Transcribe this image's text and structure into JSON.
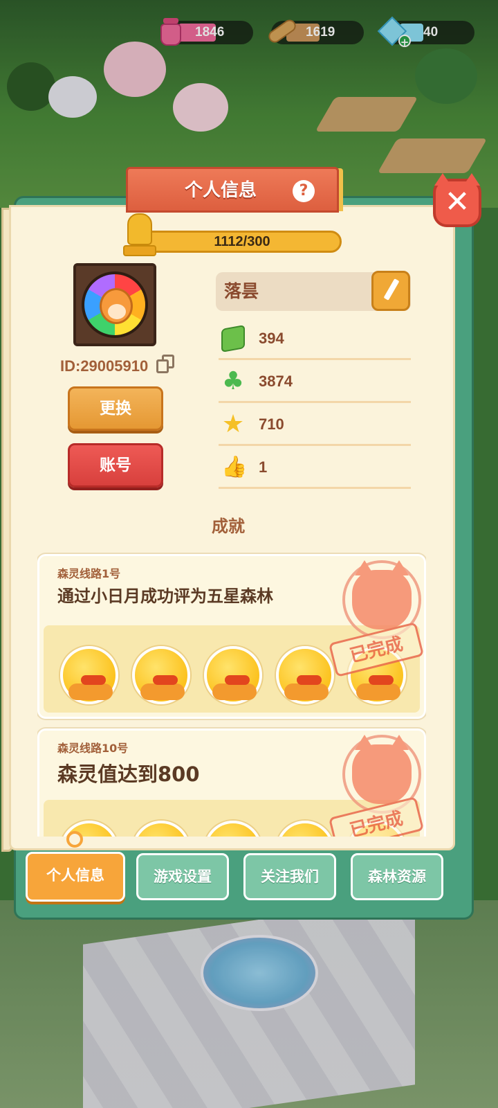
{
  "currencies": [
    {
      "icon": "ink-jar-icon",
      "value": "1846",
      "color": "#f06a9b"
    },
    {
      "icon": "wood-log-icon",
      "value": "1619",
      "color": "#d9a55a"
    },
    {
      "icon": "crystal-gem-icon",
      "value": "40",
      "color": "#8fe0f5"
    }
  ],
  "panel": {
    "title": "个人信息",
    "help_symbol": "?",
    "close_symbol": "✕"
  },
  "profile": {
    "level_progress_text": "1112/300",
    "user_id": "ID:29005910",
    "name": "落昙",
    "change_button": "更换",
    "account_button": "账号"
  },
  "stats": [
    {
      "icon": "grass-block-icon",
      "glyph": "",
      "value": "394"
    },
    {
      "icon": "clover-icon",
      "glyph": "♣",
      "value": "3874"
    },
    {
      "icon": "star-icon",
      "glyph": "★",
      "value": "710"
    },
    {
      "icon": "thumbs-up-icon",
      "glyph": "👍",
      "value": "1"
    }
  ],
  "achievements": {
    "header": "成就",
    "items": [
      {
        "route": "森灵线路1号",
        "title": "通过小日月成功评为五星森林",
        "status": "已完成",
        "reward_count": 5
      },
      {
        "route": "森灵线路10号",
        "title": "森灵值达到800",
        "status": "已完成",
        "reward_count": 5
      }
    ]
  },
  "tabs": [
    {
      "label": "个人信息",
      "active": true
    },
    {
      "label": "游戏设置",
      "active": false
    },
    {
      "label": "关注我们",
      "active": false
    },
    {
      "label": "森林资源",
      "active": false
    }
  ],
  "colors": {
    "panel_frame": "#4aa07e",
    "page_bg": "#fbf3db",
    "title_tab": "#dd5f3f",
    "accent_orange": "#f7a53a",
    "account_red": "#d8403d",
    "text_brown": "#8a4a2e"
  }
}
